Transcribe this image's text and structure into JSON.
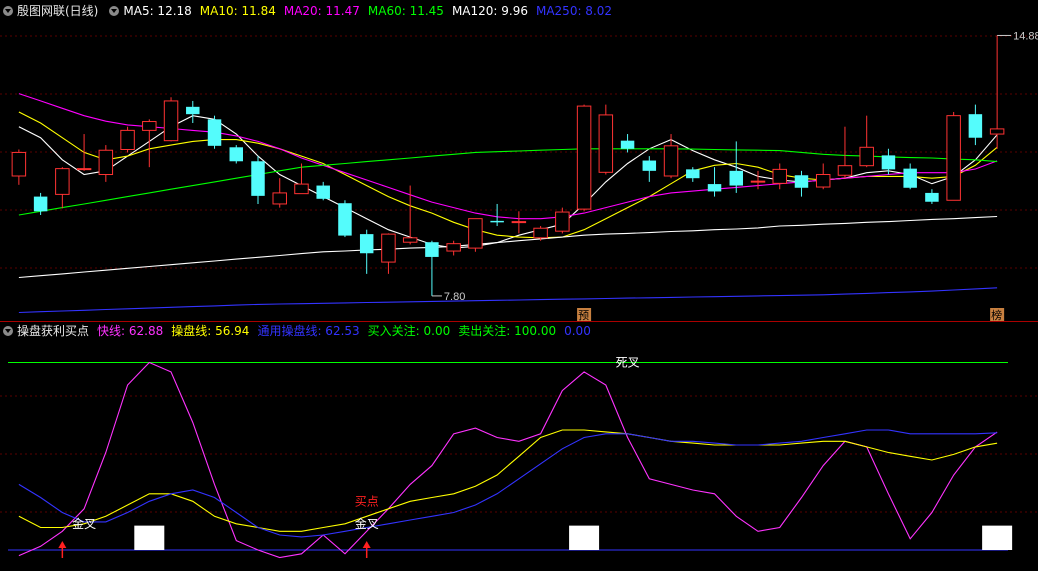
{
  "top": {
    "title": "殷图网联(日线)",
    "ma": [
      {
        "label": "MA5: 12.18",
        "color": "#ffffff"
      },
      {
        "label": "MA10: 11.84",
        "color": "#ffff00"
      },
      {
        "label": "MA20: 11.47",
        "color": "#ff00ff"
      },
      {
        "label": "MA60: 11.45",
        "color": "#00ff00"
      },
      {
        "label": "MA120: 9.96",
        "color": "#ffffff"
      },
      {
        "label": "MA250: 8.02",
        "color": "#3333ff"
      }
    ],
    "high_label": "14.88",
    "low_label": "7.80",
    "badges": [
      "预",
      "榜"
    ]
  },
  "bottom": {
    "title": "操盘获利买点",
    "items": [
      {
        "label": "快线: 62.88",
        "color": "#ff33ff"
      },
      {
        "label": "操盘线: 56.94",
        "color": "#ffff00"
      },
      {
        "label": "通用操盘线: 62.53",
        "color": "#3333ff"
      },
      {
        "label": "买入关注: 0.00",
        "color": "#00ff00"
      },
      {
        "label": "卖出关注: 100.00",
        "color": "#00ff00"
      },
      {
        "label": "0.00",
        "color": "#3333ff"
      }
    ],
    "annotations": {
      "golden_cross": "金叉",
      "death_cross": "死叉",
      "buy_point": "买点"
    }
  },
  "colors": {
    "up": "#ff3333",
    "down": "#54fcfc",
    "grid": "#5a0000"
  },
  "chart_data": [
    {
      "type": "candlestick",
      "title": "殷图网联(日线)",
      "ylim": [
        7.2,
        15.3
      ],
      "candles": [
        [
          11.06,
          11.7,
          11.78,
          10.82
        ],
        [
          10.5,
          10.1,
          10.6,
          10.0
        ],
        [
          10.56,
          11.26,
          11.3,
          10.18
        ],
        [
          11.26,
          11.26,
          12.2,
          11.2
        ],
        [
          11.1,
          11.76,
          11.9,
          10.9
        ],
        [
          11.78,
          12.3,
          12.4,
          11.7
        ],
        [
          12.3,
          12.54,
          12.6,
          11.3
        ],
        [
          12.02,
          13.1,
          13.2,
          12.0
        ],
        [
          12.94,
          12.74,
          13.1,
          12.5
        ],
        [
          12.6,
          11.88,
          12.7,
          11.8
        ],
        [
          11.84,
          11.46,
          11.9,
          11.4
        ],
        [
          11.46,
          10.52,
          11.6,
          10.3
        ],
        [
          10.3,
          10.6,
          11.0,
          10.2
        ],
        [
          10.58,
          10.84,
          11.4,
          10.6
        ],
        [
          10.8,
          10.44,
          10.9,
          10.4
        ],
        [
          10.32,
          9.44,
          10.4,
          9.4
        ],
        [
          9.48,
          8.96,
          9.6,
          8.4
        ],
        [
          8.72,
          9.48,
          9.5,
          8.4
        ],
        [
          9.26,
          9.38,
          10.8,
          9.2
        ],
        [
          9.26,
          8.86,
          9.3,
          7.8
        ],
        [
          9.02,
          9.22,
          9.3,
          8.9
        ],
        [
          9.1,
          9.9,
          9.9,
          9.0
        ],
        [
          9.84,
          9.8,
          10.3,
          9.7
        ],
        [
          9.82,
          9.82,
          10.1,
          9.5
        ],
        [
          9.38,
          9.64,
          9.7,
          9.3
        ],
        [
          9.56,
          10.08,
          10.2,
          9.5
        ],
        [
          10.16,
          12.96,
          13.0,
          10.1
        ],
        [
          11.16,
          12.72,
          13.0,
          11.1
        ],
        [
          12.02,
          11.8,
          12.2,
          11.7
        ],
        [
          11.48,
          11.2,
          11.6,
          10.9
        ],
        [
          11.06,
          11.88,
          12.2,
          11.0
        ],
        [
          11.24,
          11.0,
          11.3,
          10.9
        ],
        [
          10.84,
          10.64,
          11.3,
          10.5
        ],
        [
          11.2,
          10.8,
          12.0,
          10.6
        ],
        [
          10.92,
          10.92,
          11.2,
          10.7
        ],
        [
          10.86,
          11.24,
          11.4,
          10.7
        ],
        [
          11.08,
          10.74,
          11.2,
          10.5
        ],
        [
          10.76,
          11.1,
          11.4,
          10.7
        ],
        [
          11.08,
          11.34,
          12.4,
          11.0
        ],
        [
          11.34,
          11.84,
          12.7,
          11.3
        ],
        [
          11.62,
          11.24,
          11.8,
          11.1
        ],
        [
          11.26,
          10.74,
          11.4,
          10.7
        ],
        [
          10.6,
          10.36,
          10.7,
          10.3
        ],
        [
          10.4,
          12.7,
          12.8,
          10.4
        ],
        [
          12.74,
          12.1,
          13.0,
          11.9
        ],
        [
          12.2,
          12.34,
          14.88,
          11.8
        ]
      ],
      "ma": [
        {
          "name": "MA5",
          "color": "#ffffff",
          "values": [
            12.4,
            12.1,
            11.5,
            11.1,
            11.2,
            11.6,
            12.0,
            12.4,
            12.7,
            12.6,
            12.2,
            11.6,
            11.1,
            10.8,
            10.5,
            10.2,
            9.9,
            9.6,
            9.4,
            9.2,
            9.1,
            9.15,
            9.25,
            9.45,
            9.6,
            9.75,
            10.3,
            10.9,
            11.4,
            11.8,
            12.05,
            11.75,
            11.5,
            11.3,
            11.05,
            10.95,
            10.9,
            10.95,
            11.0,
            11.15,
            11.2,
            11.1,
            10.85,
            11.05,
            11.5,
            12.18
          ]
        },
        {
          "name": "MA10",
          "color": "#ffff00",
          "values": [
            12.8,
            12.5,
            12.1,
            11.7,
            11.5,
            11.6,
            11.8,
            11.9,
            12.0,
            12.05,
            12.05,
            11.95,
            11.8,
            11.6,
            11.4,
            11.1,
            10.8,
            10.5,
            10.25,
            10.05,
            9.8,
            9.6,
            9.45,
            9.4,
            9.38,
            9.4,
            9.6,
            9.9,
            10.2,
            10.5,
            10.85,
            11.2,
            11.35,
            11.4,
            11.3,
            11.1,
            11.0,
            10.95,
            11.0,
            11.05,
            11.05,
            11.05,
            11.0,
            11.05,
            11.35,
            11.84
          ]
        },
        {
          "name": "MA20",
          "color": "#ff00ff",
          "values": [
            13.3,
            13.1,
            12.9,
            12.7,
            12.55,
            12.45,
            12.4,
            12.35,
            12.3,
            12.25,
            12.15,
            12.0,
            11.8,
            11.55,
            11.35,
            11.15,
            10.95,
            10.75,
            10.55,
            10.35,
            10.2,
            10.05,
            9.95,
            9.9,
            9.9,
            9.95,
            10.05,
            10.2,
            10.35,
            10.5,
            10.6,
            10.65,
            10.7,
            10.75,
            10.8,
            10.85,
            10.9,
            10.95,
            11.0,
            11.05,
            11.1,
            11.15,
            11.15,
            11.15,
            11.25,
            11.47
          ]
        },
        {
          "name": "MA60",
          "color": "#00ff00",
          "values": [
            10.0,
            10.1,
            10.2,
            10.3,
            10.4,
            10.5,
            10.6,
            10.7,
            10.8,
            10.9,
            11.0,
            11.1,
            11.2,
            11.3,
            11.35,
            11.4,
            11.45,
            11.5,
            11.55,
            11.6,
            11.65,
            11.7,
            11.72,
            11.74,
            11.76,
            11.78,
            11.8,
            11.8,
            11.8,
            11.8,
            11.8,
            11.79,
            11.78,
            11.77,
            11.76,
            11.75,
            11.7,
            11.65,
            11.62,
            11.6,
            11.58,
            11.56,
            11.55,
            11.52,
            11.5,
            11.45
          ]
        },
        {
          "name": "MA120",
          "color": "#ffffff",
          "values": [
            8.3,
            8.35,
            8.4,
            8.45,
            8.5,
            8.55,
            8.6,
            8.65,
            8.7,
            8.75,
            8.8,
            8.85,
            8.9,
            8.95,
            9.0,
            9.02,
            9.05,
            9.07,
            9.1,
            9.12,
            9.15,
            9.2,
            9.25,
            9.3,
            9.35,
            9.4,
            9.45,
            9.48,
            9.5,
            9.52,
            9.55,
            9.57,
            9.6,
            9.62,
            9.65,
            9.7,
            9.72,
            9.75,
            9.77,
            9.8,
            9.82,
            9.85,
            9.88,
            9.9,
            9.93,
            9.96
          ]
        },
        {
          "name": "MA250",
          "color": "#3333ff",
          "values": [
            7.35,
            7.37,
            7.39,
            7.41,
            7.43,
            7.45,
            7.47,
            7.49,
            7.51,
            7.53,
            7.55,
            7.57,
            7.58,
            7.59,
            7.6,
            7.61,
            7.62,
            7.63,
            7.64,
            7.65,
            7.66,
            7.67,
            7.68,
            7.69,
            7.7,
            7.71,
            7.72,
            7.73,
            7.74,
            7.75,
            7.76,
            7.77,
            7.78,
            7.79,
            7.8,
            7.81,
            7.82,
            7.83,
            7.85,
            7.87,
            7.89,
            7.91,
            7.93,
            7.96,
            7.99,
            8.02
          ]
        }
      ]
    },
    {
      "type": "line",
      "title": "操盘获利买点",
      "ylim": [
        -8,
        112
      ],
      "series": [
        {
          "name": "快线",
          "color": "#ff33ff",
          "values": [
            -3,
            2,
            10,
            22,
            52,
            88,
            100,
            95,
            68,
            35,
            5,
            0,
            -4,
            -2,
            8,
            -2,
            10,
            22,
            35,
            45,
            62,
            65,
            60,
            58,
            62,
            85,
            95,
            88,
            60,
            38,
            35,
            32,
            30,
            18,
            10,
            12,
            28,
            45,
            58,
            55,
            30,
            6,
            20,
            40,
            55,
            62.88
          ]
        },
        {
          "name": "操盘线",
          "color": "#ffff00",
          "values": [
            18,
            12,
            12,
            14,
            18,
            24,
            30,
            30,
            26,
            18,
            14,
            12,
            10,
            10,
            12,
            14,
            18,
            22,
            26,
            28,
            30,
            34,
            40,
            50,
            60,
            64,
            64,
            63,
            62,
            60,
            58,
            57,
            56,
            56,
            56,
            56,
            57,
            58,
            58,
            55,
            52,
            50,
            48,
            51,
            55,
            56.94
          ]
        },
        {
          "name": "通用操盘线",
          "color": "#3333ff",
          "values": [
            35,
            28,
            20,
            15,
            15,
            20,
            26,
            30,
            32,
            28,
            20,
            12,
            8,
            7,
            8,
            10,
            12,
            14,
            16,
            18,
            20,
            24,
            30,
            38,
            46,
            54,
            60,
            62,
            62,
            60,
            58,
            58,
            57,
            56,
            56,
            57,
            58,
            60,
            62,
            64,
            64,
            62,
            62,
            62,
            62,
            62.53
          ]
        },
        {
          "name": "买入关注",
          "color": "#00ff00",
          "values": [
            0
          ]
        },
        {
          "name": "卖出关注",
          "color": "#00ff00",
          "values": [
            100
          ]
        }
      ]
    }
  ]
}
